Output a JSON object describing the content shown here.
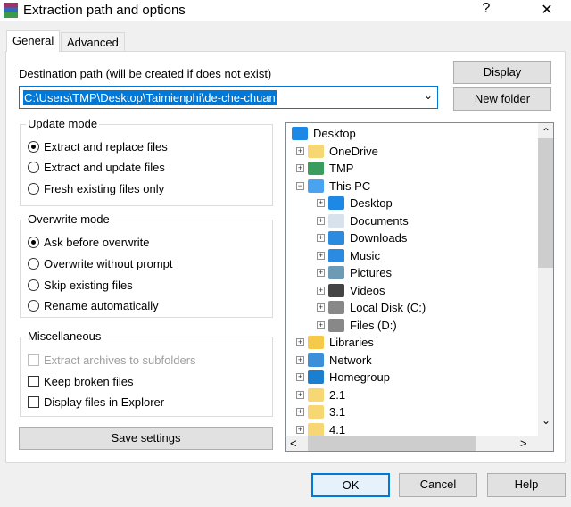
{
  "window": {
    "title": "Extraction path and options",
    "help": "?",
    "close": "✕"
  },
  "tabs": [
    {
      "label": "General"
    },
    {
      "label": "Advanced"
    }
  ],
  "destination": {
    "label": "Destination path (will be created if does not exist)",
    "value": "C:\\Users\\TMP\\Desktop\\Taimienphi\\de-che-chuan"
  },
  "buttons": {
    "display": "Display",
    "new_folder": "New folder",
    "save_settings": "Save settings",
    "ok": "OK",
    "cancel": "Cancel",
    "help": "Help"
  },
  "update_mode": {
    "label": "Update mode",
    "options": [
      "Extract and replace files",
      "Extract and update files",
      "Fresh existing files only"
    ],
    "selected": 0
  },
  "overwrite_mode": {
    "label": "Overwrite mode",
    "options": [
      "Ask before overwrite",
      "Overwrite without prompt",
      "Skip existing files",
      "Rename automatically"
    ],
    "selected": 0
  },
  "misc": {
    "label": "Miscellaneous",
    "options": [
      {
        "label": "Extract archives to subfolders",
        "checked": false,
        "disabled": true
      },
      {
        "label": "Keep broken files",
        "checked": false,
        "disabled": false
      },
      {
        "label": "Display files in Explorer",
        "checked": false,
        "disabled": false
      }
    ]
  },
  "tree": [
    {
      "label": "Desktop",
      "level": 0,
      "icon": "desktop-icon",
      "color": "#1e88e5"
    },
    {
      "label": "OneDrive",
      "level": 1,
      "icon": "folder-icon",
      "color": "#f7d774",
      "exp": "+"
    },
    {
      "label": "TMP",
      "level": 1,
      "icon": "user-icon",
      "color": "#3a9d5d",
      "exp": "+"
    },
    {
      "label": "This PC",
      "level": 1,
      "icon": "computer-icon",
      "color": "#4aa3f0",
      "exp": "−"
    },
    {
      "label": "Desktop",
      "level": 2,
      "icon": "desktop-icon",
      "color": "#1e88e5",
      "exp": "+"
    },
    {
      "label": "Documents",
      "level": 2,
      "icon": "documents-icon",
      "color": "#d8e2ec",
      "exp": "+"
    },
    {
      "label": "Downloads",
      "level": 2,
      "icon": "downloads-icon",
      "color": "#2a8be0",
      "exp": "+"
    },
    {
      "label": "Music",
      "level": 2,
      "icon": "music-icon",
      "color": "#2a8be0",
      "exp": "+"
    },
    {
      "label": "Pictures",
      "level": 2,
      "icon": "pictures-icon",
      "color": "#6d9bb5",
      "exp": "+"
    },
    {
      "label": "Videos",
      "level": 2,
      "icon": "videos-icon",
      "color": "#444",
      "exp": "+"
    },
    {
      "label": "Local Disk (C:)",
      "level": 2,
      "icon": "drive-icon",
      "color": "#888",
      "exp": "+"
    },
    {
      "label": "Files (D:)",
      "level": 2,
      "icon": "drive-icon",
      "color": "#888",
      "exp": "+"
    },
    {
      "label": "Libraries",
      "level": 1,
      "icon": "libraries-icon",
      "color": "#f7c948",
      "exp": "+"
    },
    {
      "label": "Network",
      "level": 1,
      "icon": "network-icon",
      "color": "#3c8fd8",
      "exp": "+"
    },
    {
      "label": "Homegroup",
      "level": 1,
      "icon": "homegroup-icon",
      "color": "#1a7fd0",
      "exp": "+"
    },
    {
      "label": "2.1",
      "level": 1,
      "icon": "folder-icon",
      "color": "#f7d774",
      "exp": "+"
    },
    {
      "label": "3.1",
      "level": 1,
      "icon": "folder-icon",
      "color": "#f7d774",
      "exp": "+"
    },
    {
      "label": "4.1",
      "level": 1,
      "icon": "folder-icon",
      "color": "#f7d774",
      "exp": "+"
    }
  ],
  "scroll": {
    "up": "⌃",
    "down": "⌄",
    "left": "<",
    "right": ">"
  }
}
